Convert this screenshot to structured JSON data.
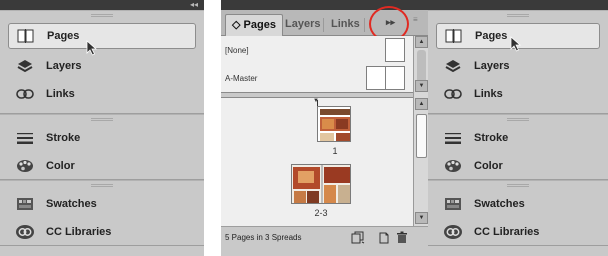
{
  "dock_left": {
    "collapse_glyph": "◂◂",
    "groups": [
      {
        "items": [
          {
            "label": "Pages",
            "icon": "pages-icon",
            "active": true
          },
          {
            "label": "Layers",
            "icon": "layers-icon"
          },
          {
            "label": "Links",
            "icon": "links-icon"
          }
        ]
      },
      {
        "items": [
          {
            "label": "Stroke",
            "icon": "stroke-icon"
          },
          {
            "label": "Color",
            "icon": "color-icon"
          }
        ]
      },
      {
        "items": [
          {
            "label": "Swatches",
            "icon": "swatches-icon"
          },
          {
            "label": "CC Libraries",
            "icon": "cc-libraries-icon"
          }
        ]
      }
    ]
  },
  "pages_panel": {
    "tabs": [
      {
        "label": "Pages",
        "prefix": "◇",
        "active": true
      },
      {
        "label": "Layers"
      },
      {
        "label": "Links"
      }
    ],
    "overflow_button": "▸▸",
    "menu_button": "≡",
    "masters": [
      {
        "label": "[None]"
      },
      {
        "label": "A-Master"
      }
    ],
    "pages": [
      {
        "number": "1"
      },
      {
        "number": "2-3"
      }
    ],
    "footer": {
      "status": "5 Pages in 3 Spreads"
    },
    "highlight_color": "#e02a22"
  },
  "dock_right": {
    "groups": [
      {
        "items": [
          {
            "label": "Pages",
            "icon": "pages-icon",
            "active": true
          },
          {
            "label": "Layers",
            "icon": "layers-icon"
          },
          {
            "label": "Links",
            "icon": "links-icon"
          }
        ]
      },
      {
        "items": [
          {
            "label": "Stroke",
            "icon": "stroke-icon"
          },
          {
            "label": "Color",
            "icon": "color-icon"
          }
        ]
      },
      {
        "items": [
          {
            "label": "Swatches",
            "icon": "swatches-icon"
          },
          {
            "label": "CC Libraries",
            "icon": "cc-libraries-icon"
          }
        ]
      }
    ]
  }
}
